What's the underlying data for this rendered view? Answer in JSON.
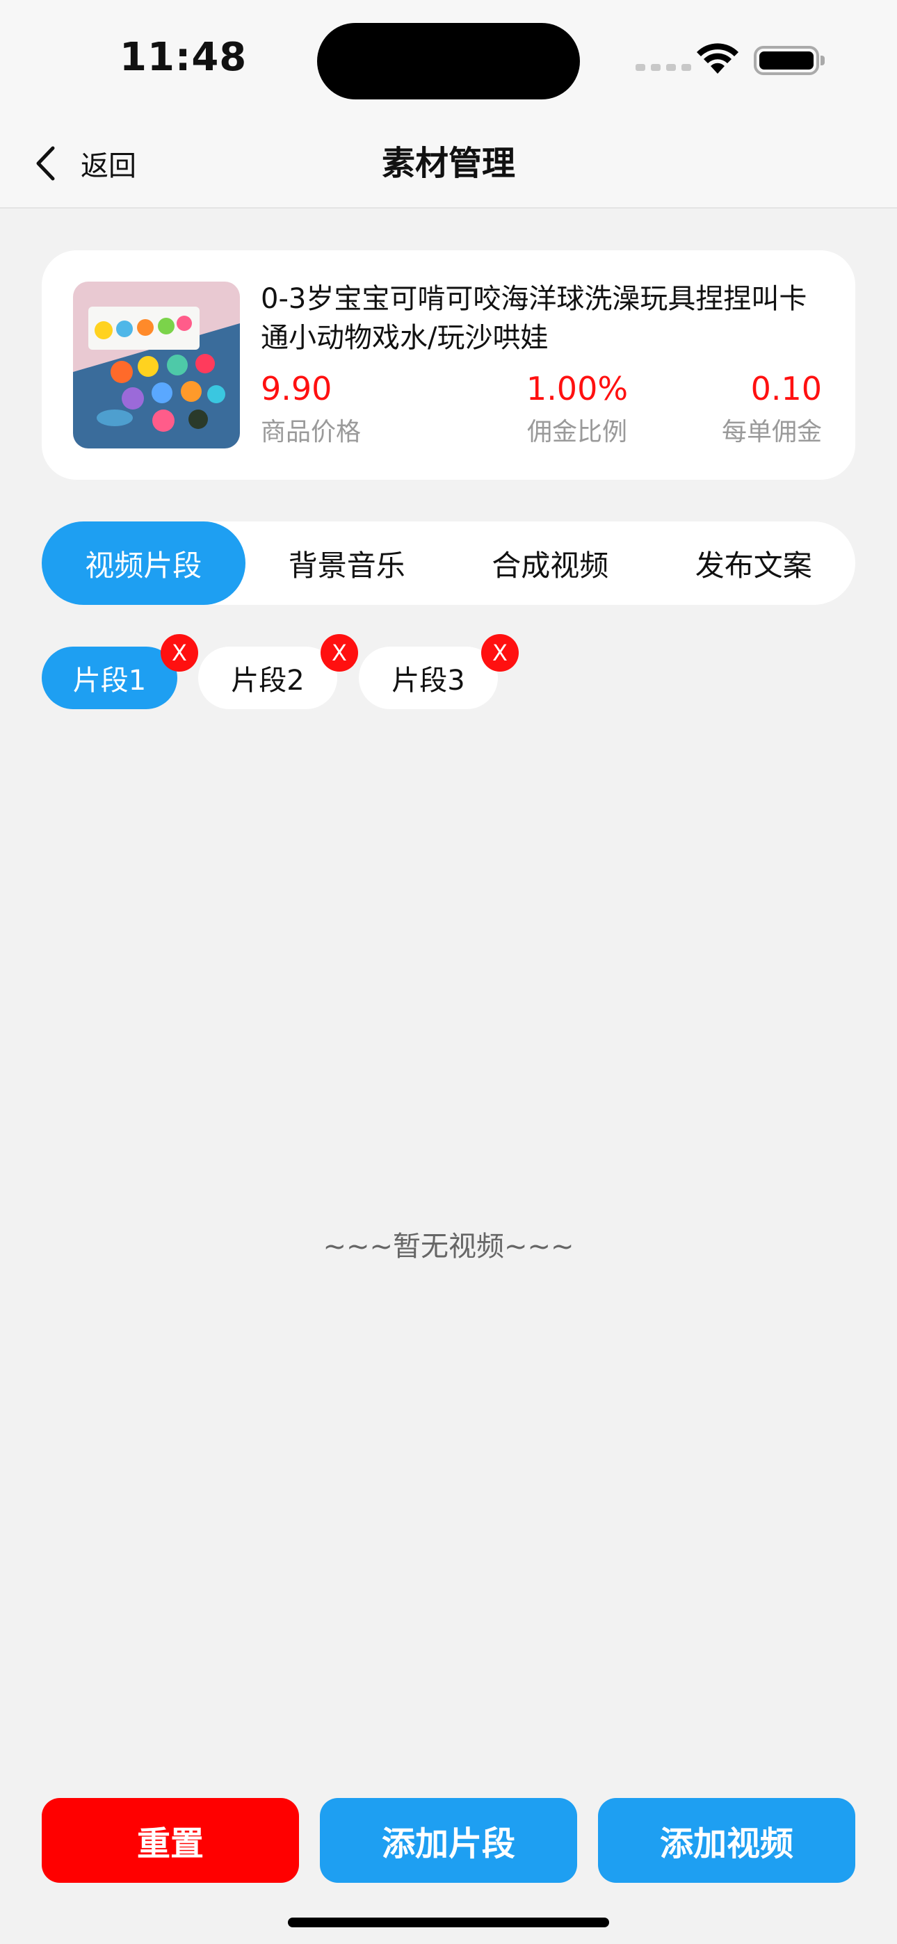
{
  "status_bar": {
    "time": "11:48"
  },
  "nav": {
    "back_label": "返回",
    "title": "素材管理"
  },
  "product": {
    "title": "0-3岁宝宝可啃可咬海洋球洗澡玩具捏捏叫卡通小动物戏水/玩沙哄娃",
    "price": {
      "value": "9.90",
      "label": "商品价格"
    },
    "commission_rate": {
      "value": "1.00%",
      "label": "佣金比例"
    },
    "commission_per_order": {
      "value": "0.10",
      "label": "每单佣金"
    }
  },
  "tabs": [
    {
      "label": "视频片段",
      "active": true
    },
    {
      "label": "背景音乐",
      "active": false
    },
    {
      "label": "合成视频",
      "active": false
    },
    {
      "label": "发布文案",
      "active": false
    }
  ],
  "segments": [
    {
      "label": "片段1",
      "active": true,
      "close": "X"
    },
    {
      "label": "片段2",
      "active": false,
      "close": "X"
    },
    {
      "label": "片段3",
      "active": false,
      "close": "X"
    }
  ],
  "empty_message": "~~~暂无视频~~~",
  "buttons": {
    "reset": "重置",
    "add_segment": "添加片段",
    "add_video": "添加视频"
  },
  "colors": {
    "accent": "#1e9ff2",
    "danger": "#ff0000",
    "price_red": "#ff1010"
  }
}
